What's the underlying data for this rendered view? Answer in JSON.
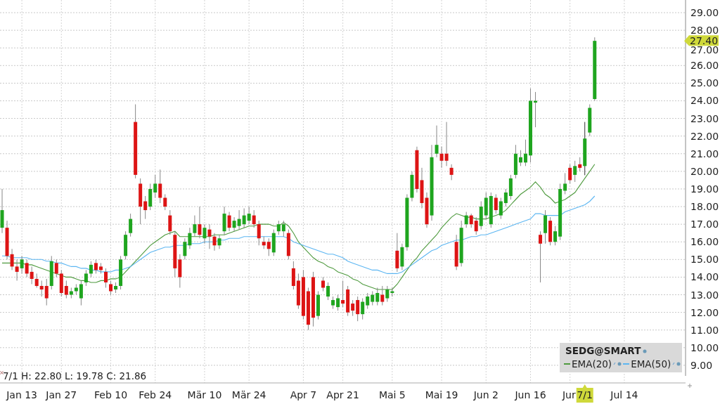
{
  "chart_data": {
    "type": "candlestick",
    "grid": true,
    "ylim": [
      8,
      29
    ],
    "categories": [
      null,
      null,
      null,
      null,
      "Jan 13",
      null,
      null,
      null,
      null,
      null,
      null,
      null,
      "Jan 27",
      null,
      null,
      null,
      null,
      null,
      null,
      null,
      null,
      null,
      "Feb 10",
      null,
      null,
      null,
      null,
      null,
      null,
      null,
      null,
      "Feb 24",
      null,
      null,
      null,
      null,
      null,
      null,
      null,
      null,
      null,
      "Mär 10",
      null,
      null,
      null,
      null,
      null,
      null,
      null,
      null,
      "Mär 24",
      null,
      null,
      null,
      null,
      null,
      null,
      null,
      null,
      null,
      null,
      "Apr 7",
      null,
      null,
      null,
      null,
      null,
      null,
      null,
      "Apr 21",
      null,
      null,
      null,
      null,
      null,
      null,
      null,
      null,
      null,
      "Mai 5",
      null,
      null,
      null,
      null,
      null,
      null,
      null,
      null,
      null,
      "Mai 19",
      null,
      null,
      null,
      null,
      null,
      null,
      null,
      null,
      "Jun 2",
      null,
      null,
      null,
      null,
      null,
      null,
      null,
      null,
      "Jun 16",
      null,
      null,
      null,
      null,
      null,
      null,
      null,
      "Jur",
      null,
      null,
      null,
      null,
      null,
      null,
      null,
      null,
      null,
      null,
      "Jul 14"
    ],
    "yticks": [
      {
        "value": 9,
        "label": "9.00"
      },
      {
        "value": 10,
        "label": "10.00"
      },
      {
        "value": 11,
        "label": "11.00"
      },
      {
        "value": 12,
        "label": "12.00"
      },
      {
        "value": 13,
        "label": "13.00"
      },
      {
        "value": 14,
        "label": "14.00"
      },
      {
        "value": 15,
        "label": "15.00"
      },
      {
        "value": 16,
        "label": "16.00"
      },
      {
        "value": 17,
        "label": "17.00"
      },
      {
        "value": 18,
        "label": "18.00"
      },
      {
        "value": 19,
        "label": "19.00"
      },
      {
        "value": 20,
        "label": "20.00"
      },
      {
        "value": 21,
        "label": "21.00"
      },
      {
        "value": 22,
        "label": "22.00"
      },
      {
        "value": 23,
        "label": "23.00"
      },
      {
        "value": 24,
        "label": "24.00"
      },
      {
        "value": 25,
        "label": "25.00"
      },
      {
        "value": 26,
        "label": "26.00"
      },
      {
        "value": 27,
        "label": "27.00"
      },
      {
        "value": 28,
        "label": "28.00"
      },
      {
        "value": 29,
        "label": "29.00"
      }
    ],
    "series": [
      {
        "name": "EMA(20)",
        "type": "line",
        "color": "#4e9a3e",
        "values": [
          14.8,
          14.8,
          14.8,
          14.8,
          14.8,
          14.7,
          14.7,
          14.6,
          14.5,
          14.4,
          14.3,
          14.2,
          14.1,
          14.0,
          14.0,
          13.9,
          13.8,
          13.8,
          13.7,
          13.7,
          13.8,
          13.8,
          13.9,
          13.9,
          14.0,
          14.3,
          14.6,
          14.9,
          15.2,
          15.5,
          15.8,
          16.0,
          16.2,
          16.4,
          16.5,
          16.6,
          16.3,
          16.3,
          16.3,
          16.3,
          16.3,
          16.3,
          16.3,
          16.4,
          16.4,
          16.4,
          16.5,
          16.6,
          16.7,
          16.8,
          16.9,
          16.9,
          17.0,
          17.0,
          17.0,
          16.9,
          16.9,
          17.1,
          16.9,
          16.5,
          16.0,
          15.7,
          15.4,
          15.1,
          14.9,
          14.8,
          14.6,
          14.5,
          14.3,
          14.2,
          14.1,
          13.9,
          13.8,
          13.6,
          13.5,
          13.4,
          13.3,
          13.3,
          13.3,
          13.3,
          13.6,
          14.0,
          14.4,
          14.8,
          15.1,
          15.5,
          15.8,
          16.1,
          16.4,
          16.8,
          17.1,
          17.4,
          17.6,
          17.5,
          17.4,
          17.4,
          17.3,
          17.3,
          17.3,
          17.4,
          17.5,
          17.6,
          17.8,
          18.1,
          18.4,
          18.7,
          18.9,
          19.1,
          19.4,
          19.1,
          18.7,
          18.5,
          18.2,
          18.3,
          18.4,
          18.6,
          18.8,
          19.2,
          19.6,
          20.0,
          20.4,
          null,
          null,
          null,
          null,
          null,
          null
        ]
      },
      {
        "name": "EMA(50)",
        "type": "line",
        "color": "#5cb6f2",
        "values": [
          15.2,
          15.2,
          15.1,
          15.1,
          15.1,
          15.1,
          15.0,
          15.0,
          15.0,
          14.9,
          14.9,
          14.8,
          14.8,
          14.7,
          14.6,
          14.6,
          14.5,
          14.5,
          14.4,
          14.4,
          14.3,
          14.3,
          14.3,
          14.4,
          14.4,
          14.5,
          14.6,
          14.8,
          15.0,
          15.2,
          15.4,
          15.5,
          15.6,
          15.7,
          15.7,
          15.8,
          15.8,
          15.8,
          15.9,
          15.9,
          15.9,
          16.0,
          16.0,
          16.0,
          16.1,
          16.1,
          16.2,
          16.2,
          16.2,
          16.3,
          16.3,
          16.3,
          16.3,
          16.3,
          16.3,
          16.3,
          16.3,
          16.3,
          16.2,
          16.0,
          15.9,
          15.8,
          15.7,
          15.6,
          15.5,
          15.4,
          15.3,
          15.3,
          15.2,
          15.1,
          14.9,
          14.8,
          14.7,
          14.6,
          14.5,
          14.4,
          14.4,
          14.3,
          14.2,
          14.2,
          14.2,
          14.3,
          14.5,
          14.7,
          14.9,
          15.1,
          15.3,
          15.5,
          15.6,
          15.8,
          15.9,
          16.0,
          16.1,
          16.1,
          16.2,
          16.3,
          16.3,
          16.4,
          16.4,
          16.5,
          16.6,
          16.7,
          16.8,
          16.9,
          17.0,
          17.1,
          17.2,
          17.3,
          17.6,
          17.6,
          17.5,
          17.5,
          17.5,
          17.5,
          17.7,
          17.8,
          17.9,
          18.0,
          18.1,
          18.3,
          18.6,
          null,
          null,
          null,
          null,
          null,
          null
        ]
      }
    ],
    "ohlc": [
      [
        16.8,
        19.0,
        16.5,
        17.8
      ],
      [
        16.8,
        17.2,
        15.0,
        15.2
      ],
      [
        15.3,
        15.6,
        14.4,
        14.6
      ],
      [
        14.6,
        15.0,
        13.8,
        14.3
      ],
      [
        14.5,
        15.2,
        14.2,
        15.0
      ],
      [
        14.8,
        15.0,
        14.0,
        14.2
      ],
      [
        14.3,
        14.6,
        13.6,
        13.9
      ],
      [
        13.9,
        14.2,
        13.4,
        13.5
      ],
      [
        13.5,
        13.8,
        12.9,
        13.3
      ],
      [
        13.5,
        13.9,
        12.4,
        12.8
      ],
      [
        13.5,
        15.2,
        13.3,
        14.9
      ],
      [
        14.8,
        15.0,
        14.0,
        14.2
      ],
      [
        14.2,
        14.4,
        12.9,
        13.1
      ],
      [
        13.5,
        13.8,
        12.8,
        13.0
      ],
      [
        13.0,
        13.4,
        12.8,
        13.2
      ],
      [
        13.2,
        13.6,
        13.0,
        13.4
      ],
      [
        12.8,
        13.8,
        12.4,
        13.6
      ],
      [
        13.7,
        14.4,
        13.5,
        14.2
      ],
      [
        14.2,
        14.9,
        14.0,
        14.7
      ],
      [
        14.8,
        15.0,
        14.2,
        14.4
      ],
      [
        14.6,
        14.8,
        14.2,
        14.4
      ],
      [
        14.3,
        14.5,
        13.4,
        13.7
      ],
      [
        13.6,
        13.8,
        13.0,
        13.2
      ],
      [
        13.3,
        13.7,
        13.1,
        13.5
      ],
      [
        13.5,
        15.2,
        13.3,
        15.0
      ],
      [
        15.2,
        16.6,
        15.0,
        16.4
      ],
      [
        16.5,
        17.6,
        16.3,
        17.3
      ],
      [
        22.8,
        23.8,
        19.6,
        19.8
      ],
      [
        19.3,
        19.6,
        17.0,
        18.0
      ],
      [
        18.3,
        18.6,
        17.3,
        17.8
      ],
      [
        18.0,
        19.3,
        17.8,
        19.0
      ],
      [
        18.8,
        19.8,
        18.5,
        19.3
      ],
      [
        19.3,
        20.1,
        18.2,
        18.5
      ],
      [
        18.5,
        18.7,
        17.8,
        18.0
      ],
      [
        17.5,
        17.8,
        16.4,
        16.6
      ],
      [
        16.4,
        16.6,
        14.0,
        14.5
      ],
      [
        15.0,
        15.3,
        13.4,
        14.0
      ],
      [
        15.2,
        16.2,
        15.0,
        16.0
      ],
      [
        15.8,
        16.8,
        15.6,
        16.5
      ],
      [
        16.5,
        17.5,
        16.3,
        17.0
      ],
      [
        17.0,
        18.0,
        16.2,
        16.4
      ],
      [
        16.2,
        17.0,
        15.9,
        16.8
      ],
      [
        16.7,
        17.0,
        15.6,
        16.3
      ],
      [
        16.3,
        16.5,
        15.5,
        15.8
      ],
      [
        15.8,
        16.4,
        15.6,
        16.2
      ],
      [
        16.6,
        18.0,
        16.4,
        17.6
      ],
      [
        17.5,
        17.7,
        16.6,
        16.8
      ],
      [
        16.8,
        17.4,
        16.6,
        17.2
      ],
      [
        16.9,
        17.8,
        16.7,
        17.3
      ],
      [
        17.0,
        17.9,
        16.8,
        17.5
      ],
      [
        17.2,
        18.0,
        17.0,
        17.6
      ],
      [
        17.5,
        17.8,
        16.8,
        17.0
      ],
      [
        17.0,
        17.2,
        15.8,
        16.2
      ],
      [
        16.0,
        16.3,
        15.6,
        15.8
      ],
      [
        16.0,
        16.2,
        15.2,
        15.6
      ],
      [
        15.4,
        16.7,
        15.2,
        16.5
      ],
      [
        16.6,
        17.2,
        16.4,
        17.0
      ],
      [
        16.6,
        17.2,
        16.3,
        17.0
      ],
      [
        16.5,
        16.7,
        15.0,
        15.2
      ],
      [
        14.5,
        14.9,
        13.3,
        13.5
      ],
      [
        13.8,
        14.2,
        12.2,
        12.4
      ],
      [
        14.0,
        14.4,
        11.6,
        11.8
      ],
      [
        13.2,
        13.4,
        11.0,
        11.3
      ],
      [
        14.0,
        14.3,
        11.2,
        11.7
      ],
      [
        11.8,
        13.2,
        11.6,
        13.0
      ],
      [
        13.8,
        14.0,
        13.2,
        13.4
      ],
      [
        12.9,
        13.7,
        12.7,
        13.5
      ],
      [
        12.4,
        12.9,
        12.2,
        12.7
      ],
      [
        12.3,
        13.0,
        12.1,
        12.8
      ],
      [
        12.7,
        13.8,
        12.3,
        12.5
      ],
      [
        13.3,
        13.5,
        11.8,
        12.0
      ],
      [
        12.5,
        12.7,
        11.8,
        12.1
      ],
      [
        12.7,
        12.9,
        11.5,
        11.9
      ],
      [
        11.9,
        12.8,
        11.6,
        12.6
      ],
      [
        12.4,
        13.1,
        12.2,
        12.9
      ],
      [
        12.6,
        13.2,
        12.4,
        13.0
      ],
      [
        12.6,
        13.4,
        12.4,
        13.1
      ],
      [
        13.0,
        13.5,
        12.4,
        12.6
      ],
      [
        12.8,
        13.5,
        12.6,
        13.3
      ],
      [
        13.1,
        13.4,
        12.9,
        13.2
      ],
      [
        15.5,
        16.5,
        14.3,
        14.5
      ],
      [
        14.6,
        15.9,
        14.4,
        15.7
      ],
      [
        15.7,
        18.7,
        15.5,
        18.5
      ],
      [
        18.5,
        20.0,
        18.3,
        19.8
      ],
      [
        21.2,
        21.4,
        18.8,
        19.0
      ],
      [
        19.5,
        20.2,
        17.9,
        18.2
      ],
      [
        18.5,
        18.8,
        16.8,
        17.0
      ],
      [
        17.5,
        21.5,
        17.2,
        20.8
      ],
      [
        21.0,
        22.6,
        20.8,
        21.5
      ],
      [
        21.0,
        21.4,
        20.2,
        20.6
      ],
      [
        21.0,
        22.8,
        20.3,
        20.6
      ],
      [
        20.2,
        20.4,
        19.5,
        19.8
      ],
      [
        16.0,
        16.4,
        14.4,
        14.6
      ],
      [
        14.8,
        17.2,
        14.6,
        16.8
      ],
      [
        17.0,
        17.7,
        16.8,
        17.5
      ],
      [
        17.5,
        17.6,
        16.8,
        17.0
      ],
      [
        17.2,
        17.4,
        16.4,
        16.6
      ],
      [
        16.9,
        18.3,
        16.7,
        18.0
      ],
      [
        17.5,
        18.8,
        17.3,
        18.5
      ],
      [
        17.0,
        18.8,
        16.8,
        18.6
      ],
      [
        18.5,
        18.7,
        17.6,
        17.8
      ],
      [
        17.5,
        18.5,
        17.3,
        18.3
      ],
      [
        18.2,
        19.0,
        18.0,
        18.8
      ],
      [
        18.6,
        19.8,
        18.4,
        19.6
      ],
      [
        19.8,
        21.5,
        19.6,
        21.0
      ],
      [
        20.5,
        21.2,
        20.3,
        20.8
      ],
      [
        20.5,
        21.8,
        20.3,
        21.0
      ],
      [
        20.9,
        24.7,
        20.5,
        24.0
      ],
      [
        23.9,
        24.5,
        22.5,
        24.0
      ],
      [
        16.4,
        16.6,
        13.7,
        15.9
      ],
      [
        16.5,
        17.8,
        15.9,
        17.5
      ],
      [
        17.2,
        17.4,
        15.8,
        16.0
      ],
      [
        16.0,
        16.9,
        15.8,
        16.6
      ],
      [
        16.3,
        19.3,
        16.1,
        19.0
      ],
      [
        18.9,
        19.9,
        18.7,
        19.3
      ],
      [
        20.2,
        20.4,
        19.3,
        19.5
      ],
      [
        19.8,
        20.6,
        19.4,
        20.3
      ],
      [
        20.4,
        20.8,
        20.0,
        20.2
      ],
      [
        20.3,
        22.8,
        19.78,
        21.86
      ],
      [
        22.2,
        23.8,
        22.0,
        23.6
      ],
      [
        24.1,
        27.6,
        24.0,
        27.4
      ],
      null,
      null,
      null,
      null,
      null,
      null
    ],
    "annotations": [
      "7/1",
      "27.40"
    ]
  },
  "info_line": "7/1 H: 22.80 L: 19.78 C: 21.86",
  "legend": {
    "symbol": "SEDG@SMART"
  }
}
